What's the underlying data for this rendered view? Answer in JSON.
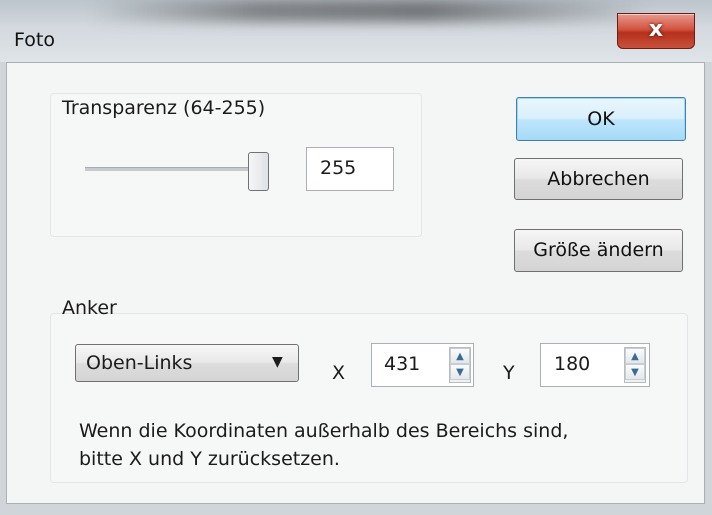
{
  "window": {
    "title": "Foto",
    "close_label": "x"
  },
  "transparency": {
    "label": "Transparenz (64-255)",
    "value": "255",
    "slider_level": 255
  },
  "buttons": {
    "ok": "OK",
    "cancel": "Abbrechen",
    "resize": "Größe ändern"
  },
  "anchor": {
    "label": "Anker",
    "selected": "Oben-Links",
    "x_label": "X",
    "x_value": "431",
    "y_label": "Y",
    "y_value": "180"
  },
  "note": {
    "line1": "Wenn die Koordinaten außerhalb des Bereichs sind,",
    "line2": "bitte X und Y zurücksetzen."
  },
  "colors": {
    "close_button": "#c8513c",
    "default_button": "#bee6fd"
  }
}
